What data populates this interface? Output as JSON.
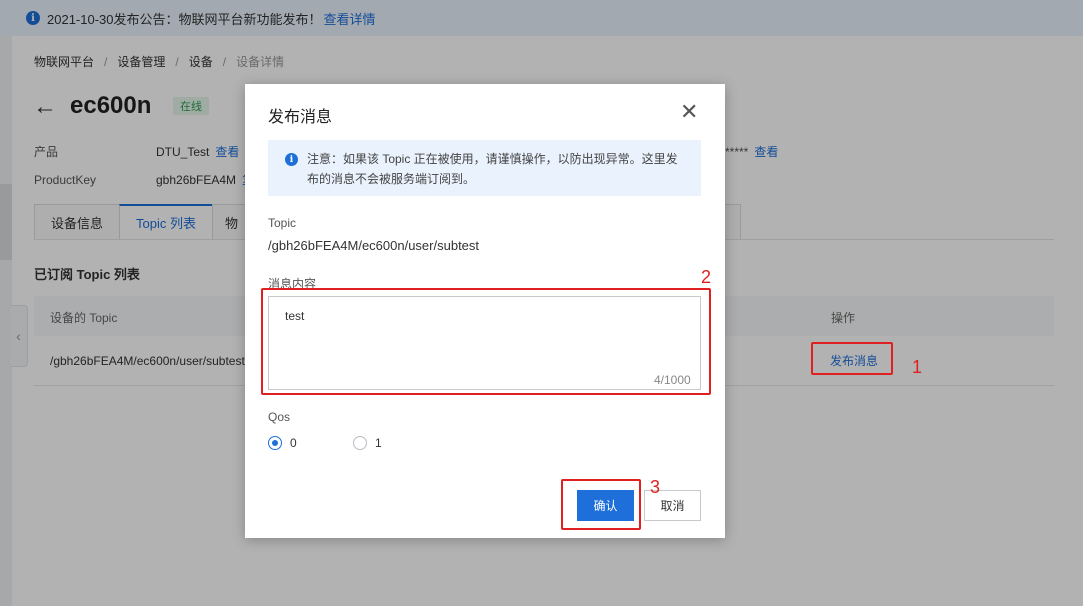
{
  "notice": {
    "text": "2021-10-30发布公告：物联网平台新功能发布！",
    "link": "查看详情",
    "icon": "info-icon"
  },
  "breadcrumb": [
    "物联网平台",
    "设备管理",
    "设备",
    "设备详情"
  ],
  "device": {
    "name": "ec600n",
    "status": "在线",
    "product_label": "产品",
    "product_value": "DTU_Test",
    "product_link": "查看",
    "productkey_label": "ProductKey",
    "productkey_value": "gbh26bFEA4M",
    "productkey_tail": "复",
    "secret_masked": "*****",
    "secret_link": "查看"
  },
  "tabs": [
    {
      "label": "设备信息",
      "active": false
    },
    {
      "label": "Topic 列表",
      "active": true
    },
    {
      "label": "物",
      "active": false
    }
  ],
  "section_title": "已订阅 Topic 列表",
  "table": {
    "columns": [
      "设备的 Topic",
      "操作"
    ],
    "rows": [
      {
        "topic": "/gbh26bFEA4M/ec600n/user/subtest",
        "action": "发布消息"
      }
    ]
  },
  "modal": {
    "title": "发布消息",
    "alert": "注意：如果该 Topic 正在被使用，请谨慎操作，以防出现异常。这里发布的消息不会被服务端订阅到。",
    "topic_label": "Topic",
    "topic_value": "/gbh26bFEA4M/ec600n/user/subtest",
    "content_label": "消息内容",
    "content_value": "test",
    "counter": "4/1000",
    "qos_label": "Qos",
    "qos_options": [
      "0",
      "1"
    ],
    "qos_selected": "0",
    "confirm_label": "确认",
    "cancel_label": "取消"
  },
  "annotations": [
    "1",
    "2",
    "3"
  ],
  "colors": {
    "accent": "#1e6fd9",
    "annotation": "#e02020",
    "online": "#2e9c53"
  }
}
